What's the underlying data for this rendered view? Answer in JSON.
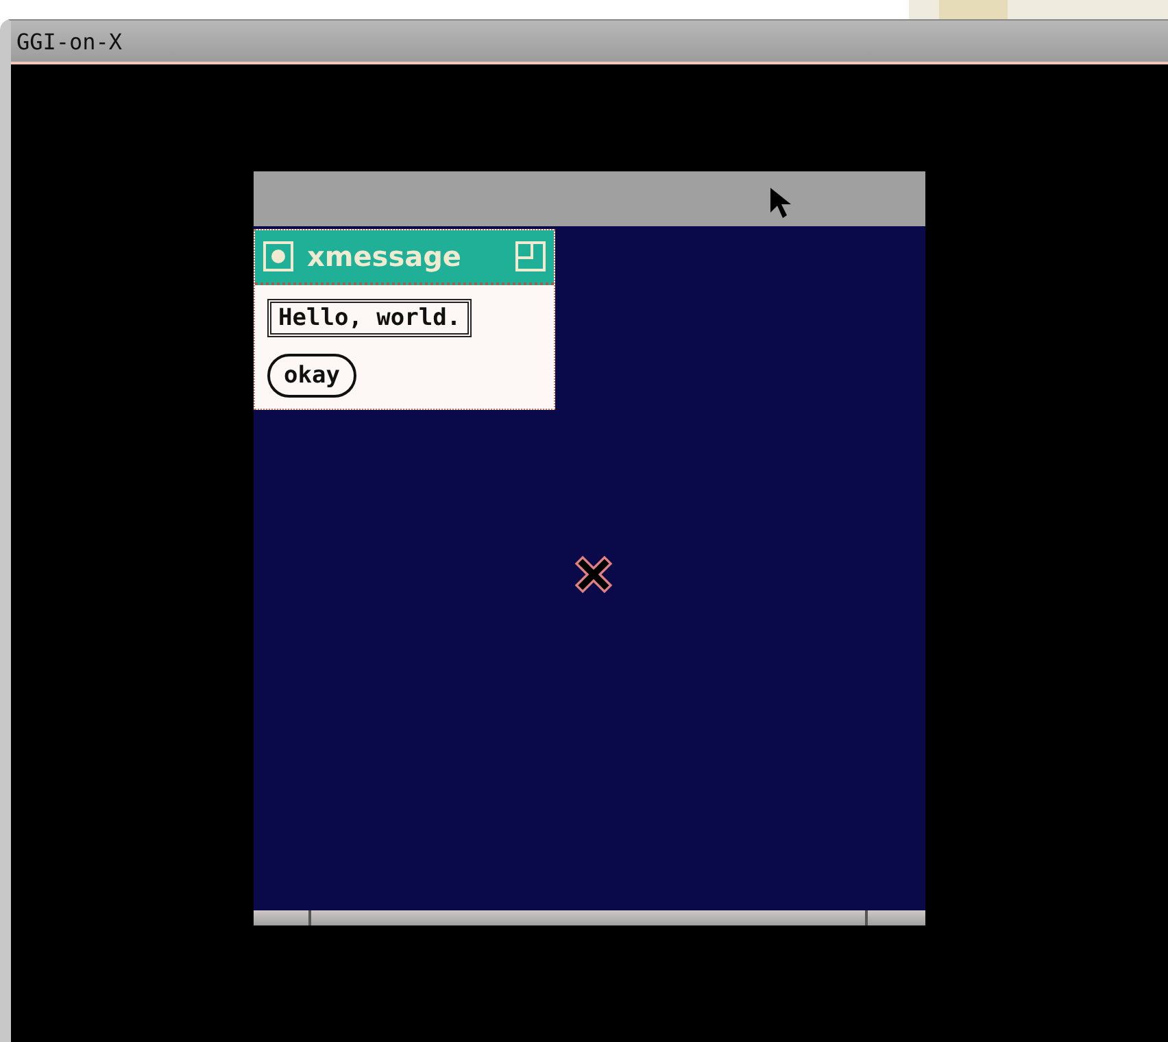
{
  "window": {
    "title": "GGI-on-X"
  },
  "xmessage": {
    "title": "xmessage",
    "message": "Hello, world.",
    "button": "okay"
  }
}
